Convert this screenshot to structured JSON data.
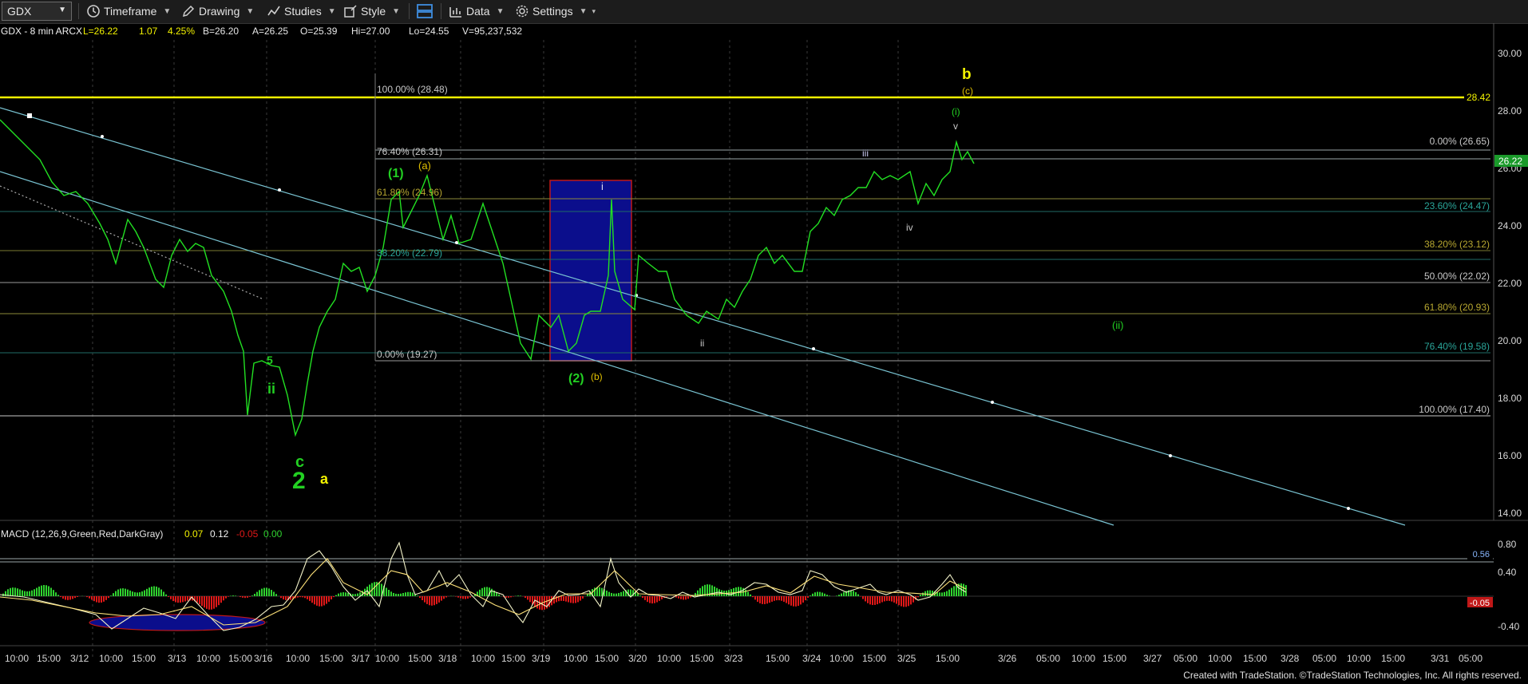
{
  "toolbar": {
    "symbol": "GDX",
    "timeframe_label": "Timeframe",
    "drawing_label": "Drawing",
    "studies_label": "Studies",
    "style_label": "Style",
    "data_label": "Data",
    "settings_label": "Settings"
  },
  "header": {
    "symbol_info": "GDX - 8 min  ARCX",
    "last": "L=26.22",
    "change": "1.07",
    "pct": "4.25%",
    "bid": "B=26.20",
    "ask": "A=26.25",
    "open": "O=25.39",
    "high": "Hi=27.00",
    "low": "Lo=24.55",
    "volume": "V=95,237,532"
  },
  "price_axis": {
    "ticks": [
      "30.00",
      "28.00",
      "26.00",
      "24.00",
      "22.00",
      "20.00",
      "18.00",
      "16.00",
      "14.00"
    ],
    "marker_yellow": "28.42",
    "marker_green": "26.22"
  },
  "time_axis": {
    "labels": [
      "10:00",
      "15:00",
      "3/12",
      "10:00",
      "15:00",
      "3/13",
      "10:00",
      "15:00",
      "3/16",
      "10:00",
      "15:00",
      "3/17",
      "10:00",
      "15:00",
      "3/18",
      "10:00",
      "15:00",
      "3/19",
      "10:00",
      "15:00",
      "3/20",
      "10:00",
      "15:00",
      "3/23",
      "15:00",
      "3/24",
      "10:00",
      "15:00",
      "3/25",
      "15:00",
      "3/26",
      "05:00",
      "10:00",
      "15:00",
      "3/27",
      "05:00",
      "10:00",
      "15:00",
      "3/28",
      "05:00",
      "10:00",
      "15:00",
      "3/31",
      "05:00"
    ]
  },
  "fib_left": {
    "l100": "100.00% (28.48)",
    "l764": "76.40% (26.31)",
    "l618": "61.80% (24.96)",
    "l382": "38.20% (22.79)",
    "l0": "0.00% (19.27)"
  },
  "fib_right": {
    "l0": "0.00% (26.65)",
    "l236": "23.60% (24.47)",
    "l382": "38.20% (23.12)",
    "l50": "50.00% (22.02)",
    "l618": "61.80% (20.93)",
    "l764": "76.40% (19.58)",
    "l100": "100.00% (17.40)"
  },
  "waves": {
    "big_2": "2",
    "c": "c",
    "a": "a",
    "ii_small": "ii",
    "five_small": "5",
    "w1": "(1)",
    "wa": "(a)",
    "wi": "i",
    "w2": "(2)",
    "wb": "(b)",
    "wii": "ii",
    "wiii": "iii",
    "wiv": "iv",
    "wv": "v",
    "w_i_paren": "(i)",
    "w_c_paren": "(c)",
    "b_big": "b",
    "w_ii_paren": "(ii)"
  },
  "macd": {
    "label": "MACD (12,26,9,Green,Red,DarkGray)",
    "v1": "0.07",
    "v2": "0.12",
    "v3": "-0.05",
    "v4": "0.00",
    "ticks": [
      "0.80",
      "0.40",
      "0.00",
      "-0.40"
    ],
    "marker_blue": "0.56",
    "marker_red": "-0.05"
  },
  "colors": {
    "background": "#000000",
    "price_line": "#22e022",
    "yellow_line": "#f2f200",
    "channel": "#79c3d2",
    "fib_box": "#0b0e8c",
    "macd_pos": "#2fd22f",
    "macd_neg": "#e01818"
  },
  "footer": {
    "credit": "Created with TradeStation. ©TradeStation Technologies, Inc. All rights reserved."
  }
}
